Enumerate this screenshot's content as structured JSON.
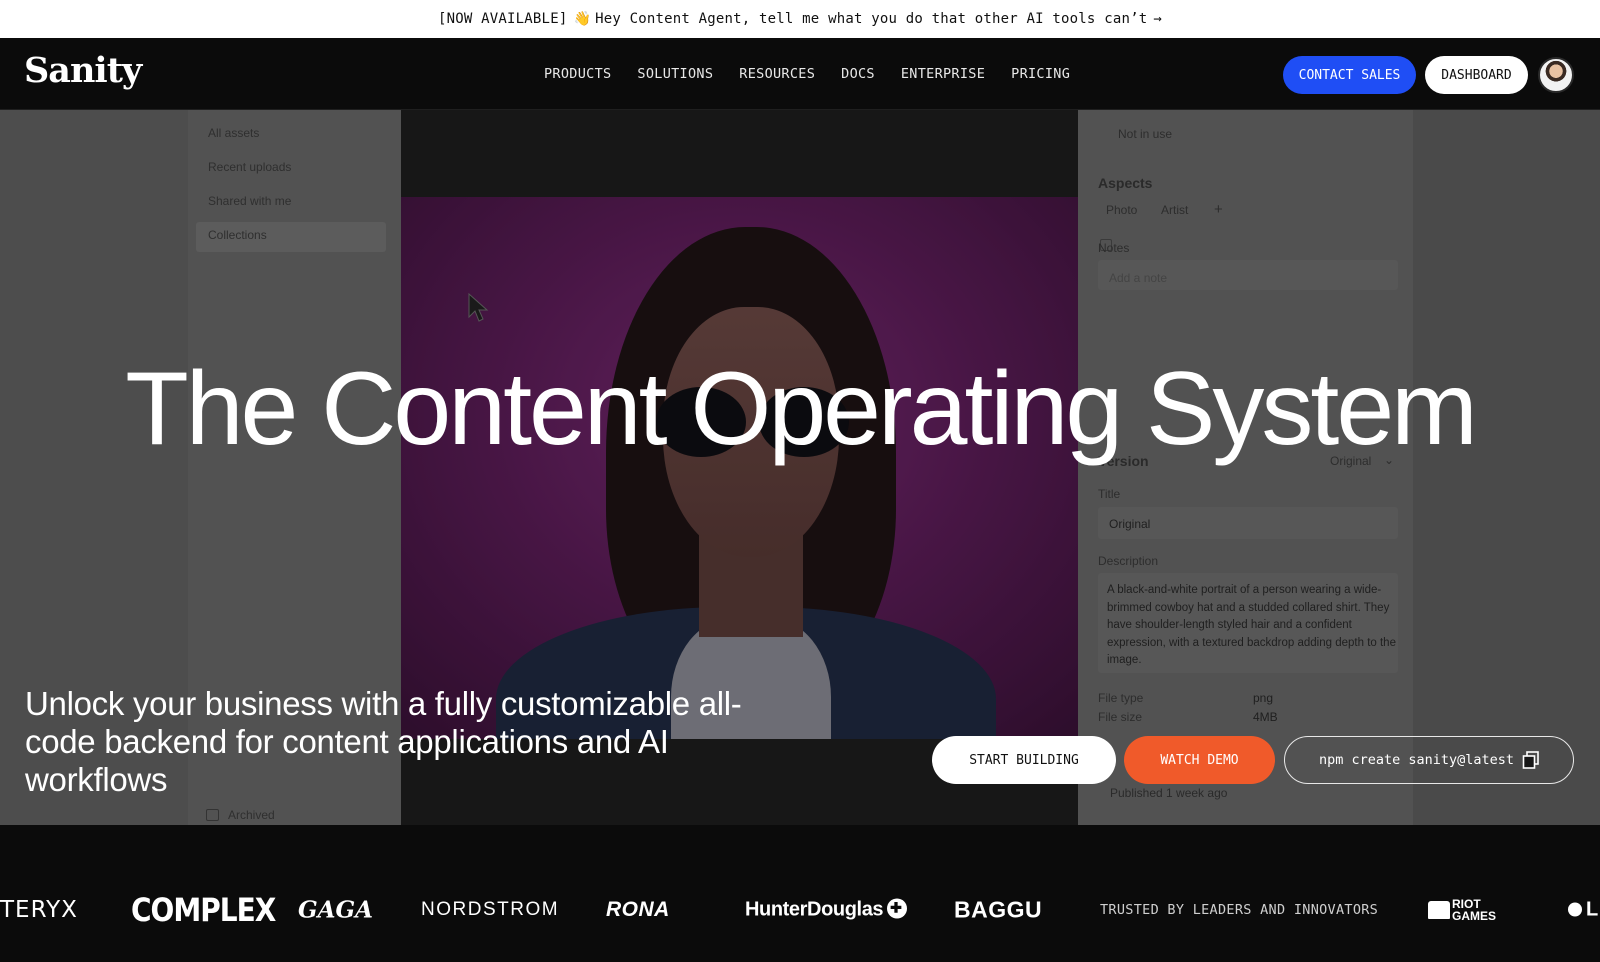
{
  "announcement": {
    "tag": "[NOW AVAILABLE]",
    "emoji": "👋",
    "message": "Hey Content Agent, tell me what you do that other AI tools can’t",
    "arrow": "→"
  },
  "nav": {
    "logo": "Sanity",
    "items": [
      "PRODUCTS",
      "SOLUTIONS",
      "RESOURCES",
      "DOCS",
      "ENTERPRISE",
      "PRICING"
    ],
    "contact_sales": "CONTACT SALES",
    "dashboard": "DASHBOARD"
  },
  "hero": {
    "title": "The Content Operating System",
    "subtitle": "Unlock your business with a fully customizable all-code backend for content applications and AI workflows",
    "start_building": "START BUILDING",
    "watch_demo": "WATCH DEMO",
    "npm_command": "npm create sanity@latest"
  },
  "background_ui": {
    "sidebar": [
      "All assets",
      "Recent uploads",
      "Shared with me",
      "Collections"
    ],
    "archived": "Archived",
    "not_in_use": "Not in use",
    "aspects_heading": "Aspects",
    "aspect_tags": [
      "Photo",
      "Artist",
      "+"
    ],
    "notes_label": "Notes",
    "notes_placeholder": "Add a note",
    "version_heading": "Version",
    "version_value": "Original",
    "title_label": "Title",
    "title_value": "Original",
    "description_label": "Description",
    "description": "A black-and-white portrait of a person wearing a wide-brimmed cowboy hat and a studded collared shirt. They have shoulder-length styled hair and a confident expression, with a textured backdrop adding depth to the image.",
    "file_type_label": "File type",
    "file_type": "png",
    "file_size_label": "File size",
    "file_size": "4MB",
    "published": "Published 1 week ago"
  },
  "logos": {
    "items": [
      "TERYX",
      "COMPLEX",
      "GAGA",
      "NORDSTROM",
      "RONA",
      "HunterDouglas",
      "BAGGU"
    ],
    "trusted": "TRUSTED BY LEADERS AND INNOVATORS",
    "riot_line1": "RIOT",
    "riot_line2": "GAMES",
    "last_partial": "L"
  },
  "colors": {
    "accent_blue": "#1f4ef5",
    "accent_orange": "#f05a2a"
  }
}
